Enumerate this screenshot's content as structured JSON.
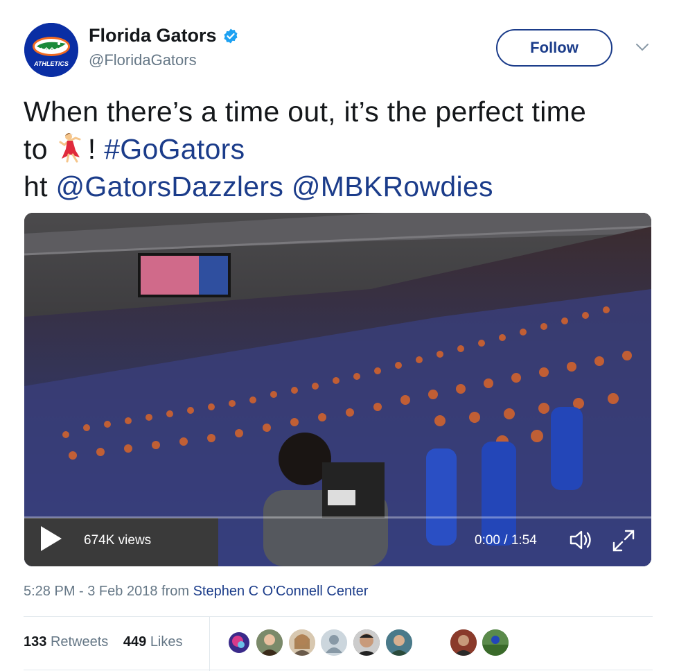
{
  "account": {
    "display_name": "Florida Gators",
    "handle": "@FloridaGators",
    "verified": true,
    "logo_text": "ATHLETICS"
  },
  "follow_label": "Follow",
  "tweet": {
    "text_part1": "When there’s a time out, it’s the perfect time",
    "text_part2_a": "to",
    "text_part2_b": "!",
    "hashtag": "#GoGators",
    "ht": "ht",
    "mention1": "@GatorsDazzlers",
    "mention2": "@MBKRowdies"
  },
  "video": {
    "views": "674K views",
    "time": "0:00 / 1:54"
  },
  "meta": {
    "timestamp": "5:28 PM - 3 Feb 2018",
    "from": "from",
    "location": "Stephen C O'Connell Center"
  },
  "stats": {
    "retweets_count": "133",
    "retweets_label": "Retweets",
    "likes_count": "449",
    "likes_label": "Likes"
  },
  "colors": {
    "link": "#1b3c8a",
    "muted": "#657786",
    "verified": "#1da1f2"
  }
}
